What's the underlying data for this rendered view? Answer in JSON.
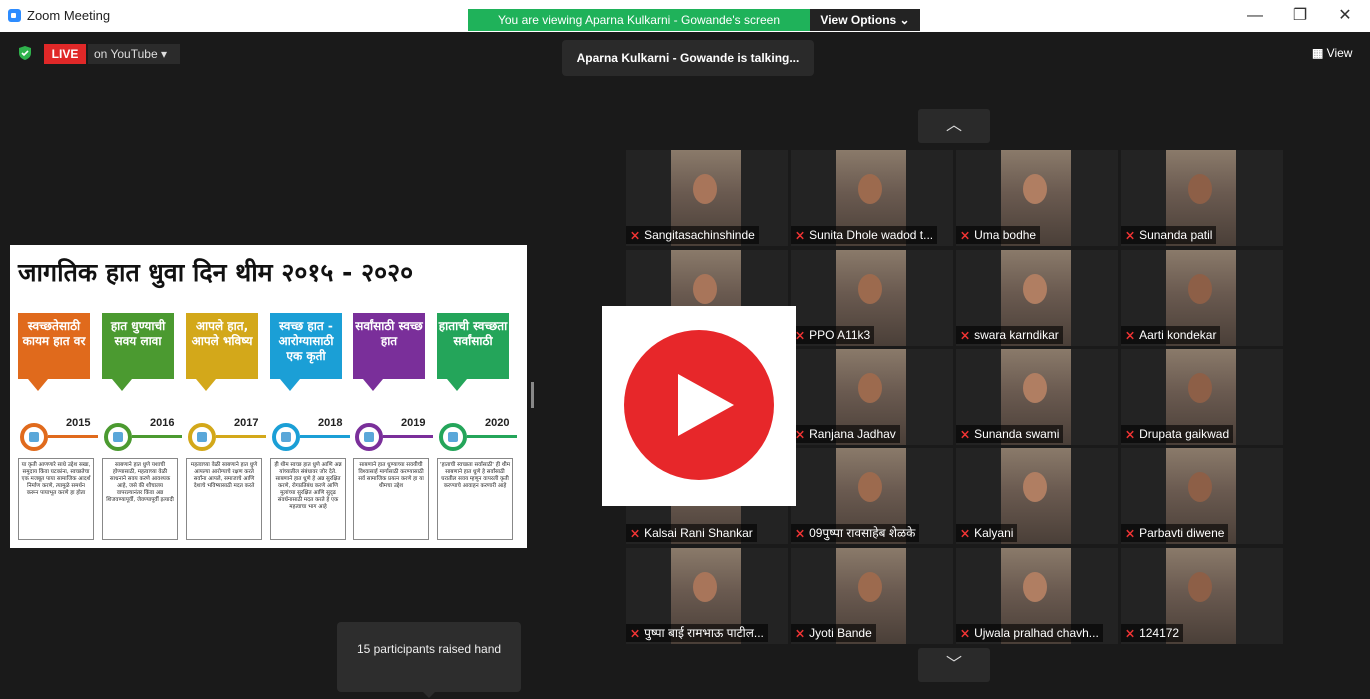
{
  "window": {
    "title": "Zoom Meeting",
    "share_banner": "You are viewing Aparna Kulkarni - Gowande's screen",
    "view_options": "View Options ⌄",
    "minimize": "—",
    "restore": "❐",
    "close": "✕"
  },
  "toolbar": {
    "live_label": "LIVE",
    "youtube_label": "on YouTube ▾",
    "talking_text": "Aparna Kulkarni - Gowande is talking...",
    "view_label": "View",
    "grid_up": "︿",
    "grid_down": "﹀"
  },
  "slide": {
    "title": "जागतिक हात धुवा दिन थीम २०१५ - २०२०",
    "themes": [
      {
        "text": "स्वच्छतेसाठी कायम हात वर",
        "color": "#e06a1c",
        "year": "2015",
        "desc": "या कृती आणणारे साधे उद्देश सखा, समुदाय किंवा घटकांना, स्वच्छतेचा एक मजबूत पाया सामाजिक आदर्श निर्माण करणे, त्यामुळे समर्थन करून पायाभूत करणे हा होता"
      },
      {
        "text": "हात धुण्याची सवय लावा",
        "color": "#4b9a30",
        "year": "2016",
        "desc": "साबणाने हात धुणे यशाची होण्यासाठी, महत्वाच्या वेळी साधनाने सवय करणे आवश्यक आहे, जसे की शौचालय वापरल्यानंतर किंवा अन्न शिजवण्यापूर्वी, जेवण्यापूर्वी इत्यादी"
      },
      {
        "text": "आपले हात, आपले भविष्य",
        "color": "#d3a81a",
        "year": "2017",
        "desc": "महत्वाच्या वेळी साबणाने हात धुणे आपल्या आरोग्याचे रक्षण करते सर्वांना आपले, समाजाचे आणि देशाचे भविष्यासाठी मदत करते"
      },
      {
        "text": "स्वच्छ हात - आरोग्यासाठी एक कृती",
        "color": "#1b9fd6",
        "year": "2018",
        "desc": "ही थीम स्वच्छ हात धुणे आणि अन्न यांच्यातील संबंधावर जोर देते. साबणाने हात धुणे हे अन्न सुरक्षित करणे, रोगप्रतिबंध करणे आणि मुलांच्या सुरक्षित आणि सुदृढ संवर्धनासाठी मदत करते हे एक महत्वाचा भाग आहे"
      },
      {
        "text": "सर्वांसाठी स्वच्छ हात",
        "color": "#7a2f9a",
        "year": "2019",
        "desc": "साबणाने हात धुण्याच्या सवयीची विश्वासार्ह मार्गासाठी करण्यासाठी सर्व सामाजिक प्रयत्न करणे हा या थीमचा उद्देश"
      },
      {
        "text": "हाताची स्वच्छता सर्वांसाठी",
        "color": "#24a55a",
        "year": "2020",
        "desc": "'हाताची स्वच्छता सर्वांसाठी' ही थीम साबणाने हात धुणे हे सर्वांसाठी घरातील सवय म्हणून वापरली कृती करण्याचे आवाहन करणारी आहे"
      }
    ]
  },
  "participants": [
    {
      "name": "Sangitasachinshinde"
    },
    {
      "name": "Sunita Dhole wadod t..."
    },
    {
      "name": "Uma bodhe"
    },
    {
      "name": "Sunanda patil"
    },
    {
      "name": ""
    },
    {
      "name": "PPO A11k3"
    },
    {
      "name": "swara karndikar"
    },
    {
      "name": "Aarti kondekar"
    },
    {
      "name": ""
    },
    {
      "name": "Ranjana Jadhav"
    },
    {
      "name": "Sunanda swami"
    },
    {
      "name": "Drupata gaikwad"
    },
    {
      "name": "Kalsai Rani Shankar"
    },
    {
      "name": "09पुष्पा रावसाहेब शेळके"
    },
    {
      "name": "Kalyani"
    },
    {
      "name": "Parbavti diwene"
    },
    {
      "name": "पुष्पा बाई रामभाऊ पाटील..."
    },
    {
      "name": "Jyoti Bande"
    },
    {
      "name": "Ujwala pralhad chavh..."
    },
    {
      "name": "124172"
    }
  ],
  "tooltip": {
    "text": "15 participants raised hand"
  },
  "colors": {
    "banner_green": "#1fb25a",
    "live_red": "#e02828",
    "youtube_red": "#e7272a",
    "mic_muted": "#e33333"
  }
}
